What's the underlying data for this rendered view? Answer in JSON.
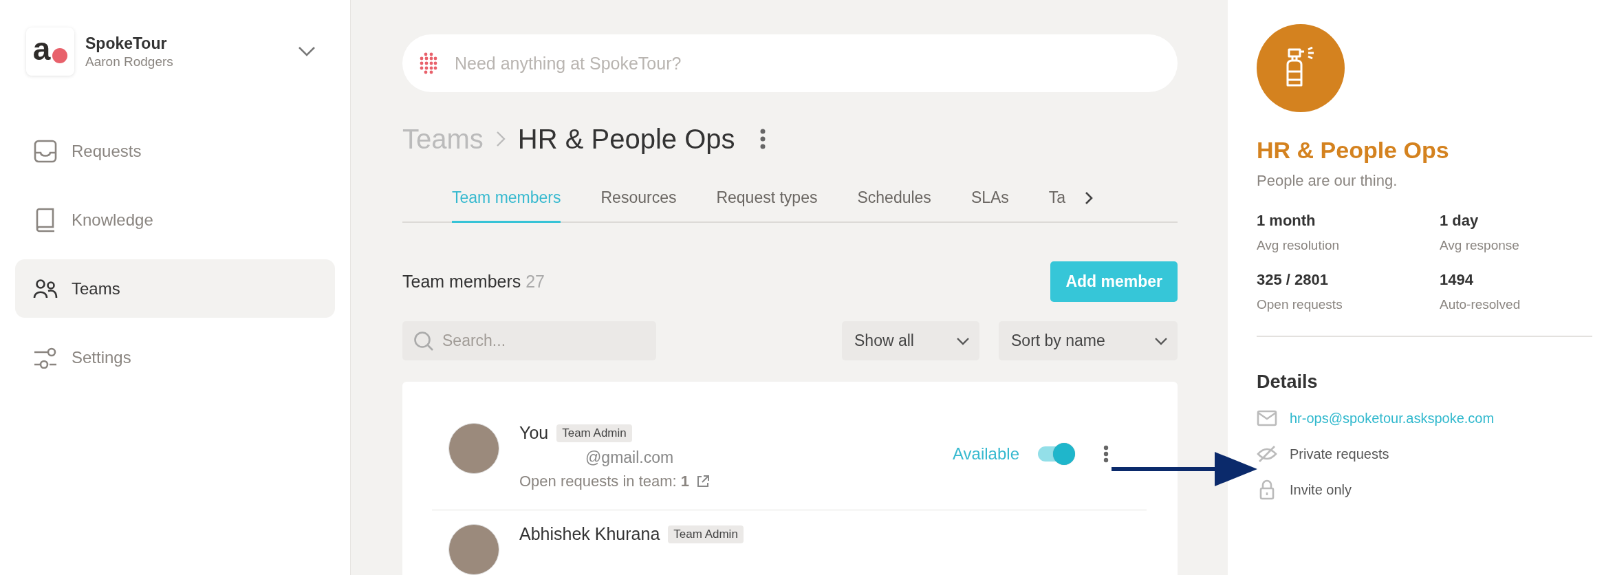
{
  "workspace": {
    "logo_letter": "a",
    "name": "SpokeTour",
    "user": "Aaron Rodgers"
  },
  "nav": [
    {
      "label": "Requests",
      "kind": "inbox",
      "selected": false
    },
    {
      "label": "Knowledge",
      "kind": "book",
      "selected": false
    },
    {
      "label": "Teams",
      "kind": "people",
      "selected": true
    },
    {
      "label": "Settings",
      "kind": "sliders",
      "selected": false
    }
  ],
  "ask_bar": {
    "placeholder": "Need anything at SpokeTour?"
  },
  "breadcrumb": {
    "parent": "Teams",
    "current": "HR & People Ops"
  },
  "tabs": [
    {
      "label": "Team members",
      "selected": true
    },
    {
      "label": "Resources",
      "selected": false
    },
    {
      "label": "Request types",
      "selected": false
    },
    {
      "label": "Schedules",
      "selected": false
    },
    {
      "label": "SLAs",
      "selected": false
    },
    {
      "label": "Ta",
      "selected": false
    }
  ],
  "members_header": {
    "title": "Team members",
    "count": "27",
    "add_button": "Add member"
  },
  "filters": {
    "search_placeholder": "Search...",
    "show": "Show all",
    "sort": "Sort by name"
  },
  "members": [
    {
      "name": "You",
      "role": "Team Admin",
      "email": "@gmail.com",
      "open_requests": "Open requests in team: **1**",
      "status": "Available",
      "available": true
    },
    {
      "name": "Abhishek Khurana",
      "role": "Team Admin"
    }
  ],
  "team": {
    "name": "HR & People Ops",
    "tagline": "People are our thing.",
    "stats": [
      {
        "value": "1 month",
        "label": "Avg resolution"
      },
      {
        "value": "1 day",
        "label": "Avg response"
      },
      {
        "value": "325 / 2801",
        "label": "Open requests"
      },
      {
        "value": "1494",
        "label": "Auto-resolved"
      }
    ],
    "details_title": "Details",
    "details": [
      {
        "kind": "email",
        "text": "hr-ops@spoketour.askspoke.com"
      },
      {
        "kind": "private",
        "text": "Private requests"
      },
      {
        "kind": "invite",
        "text": "Invite only"
      }
    ]
  }
}
